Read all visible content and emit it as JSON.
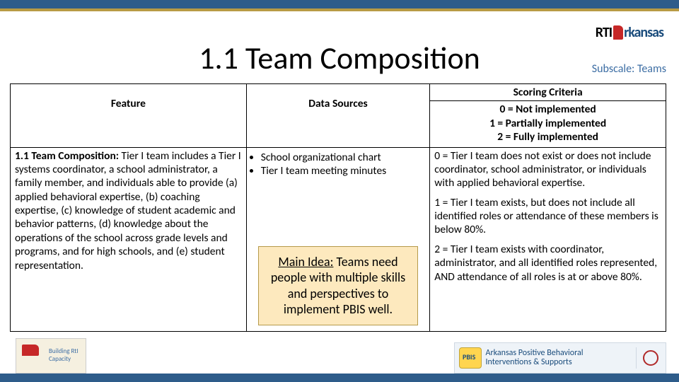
{
  "header": {
    "title": "1.1 Team Composition",
    "subscale": "Subscale: Teams",
    "logo_rti_left": "RTI",
    "logo_rti_right": "rkansas"
  },
  "table": {
    "headers": {
      "feature": "Feature",
      "data_sources": "Data Sources",
      "scoring_criteria": "Scoring Criteria"
    },
    "criteria_legend": {
      "zero": "0 = Not implemented",
      "one": "1 = Partially implemented",
      "two": "2 = Fully implemented"
    },
    "feature_title": "1.1 Team Composition:",
    "feature_body": " Tier I team includes a Tier I systems coordinator, a school administrator, a family member, and individuals able to provide (a) applied behavioral expertise, (b) coaching expertise, (c) knowledge of student academic and behavior patterns, (d) knowledge about the operations of the school across grade levels and programs, and for high schools, and (e) student representation.",
    "data_sources": {
      "items": [
        "School organizational chart",
        "Tier I team meeting minutes"
      ]
    },
    "main_idea": {
      "label": "Main Idea:",
      "text": " Teams need people with multiple skills and perspectives to implement PBIS well."
    },
    "scoring": {
      "s0": "0 = Tier I team does not exist or does not include coordinator, school administrator, or individuals with applied behavioral expertise.",
      "s1": "1 = Tier I team exists, but does not include all identified roles or attendance of these members is below 80%.",
      "s2": "2 = Tier I team exists with coordinator, administrator, and all identified roles represented, AND attendance of all roles is at or above 80%."
    }
  },
  "footer": {
    "left_caption": "Building RtI Capacity",
    "right_text": "Arkansas Positive Behavioral Interventions & Supports"
  }
}
